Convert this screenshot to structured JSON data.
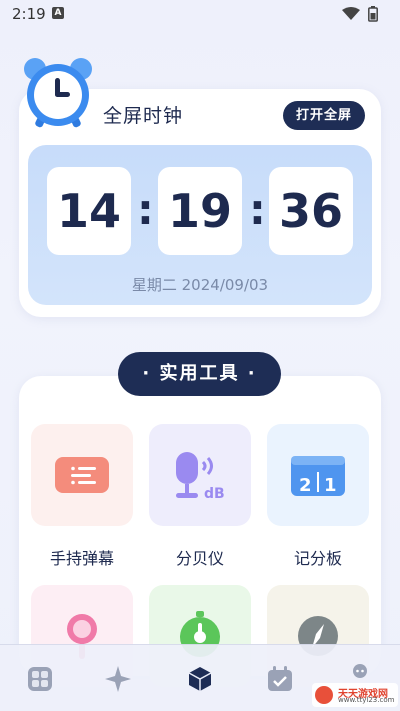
{
  "status_bar": {
    "time": "2:19",
    "a_icon": "A"
  },
  "clock": {
    "title": "全屏时钟",
    "fullscreen_button": "打开全屏",
    "hours": "14",
    "minutes": "19",
    "seconds": "36",
    "separator": ":",
    "date": "星期二 2024/09/03"
  },
  "tools": {
    "section_title": "· 实用工具 ·",
    "items": [
      {
        "label": "手持弹幕",
        "icon": "barrage-icon"
      },
      {
        "label": "分贝仪",
        "icon": "decibel-mic-icon"
      },
      {
        "label": "记分板",
        "icon": "scoreboard-icon"
      },
      {
        "label": "",
        "icon": "magnifier-icon"
      },
      {
        "label": "",
        "icon": "stopwatch-icon"
      },
      {
        "label": "",
        "icon": "compass-icon"
      }
    ]
  },
  "nav": {
    "items": [
      {
        "icon": "grid-apps-icon",
        "active": false
      },
      {
        "icon": "sparkle-diamond-icon",
        "active": false
      },
      {
        "icon": "cube-icon",
        "active": true
      },
      {
        "icon": "calendar-check-icon",
        "active": false
      },
      {
        "icon": "profile-icon",
        "active": false
      }
    ]
  },
  "watermark": {
    "main": "天天游戏网",
    "sub": "www.ttyl23.com"
  },
  "colors": {
    "primary_dark": "#1e2d55",
    "clock_panel": "#c7dcfa",
    "date_text": "#7a8aa8"
  }
}
